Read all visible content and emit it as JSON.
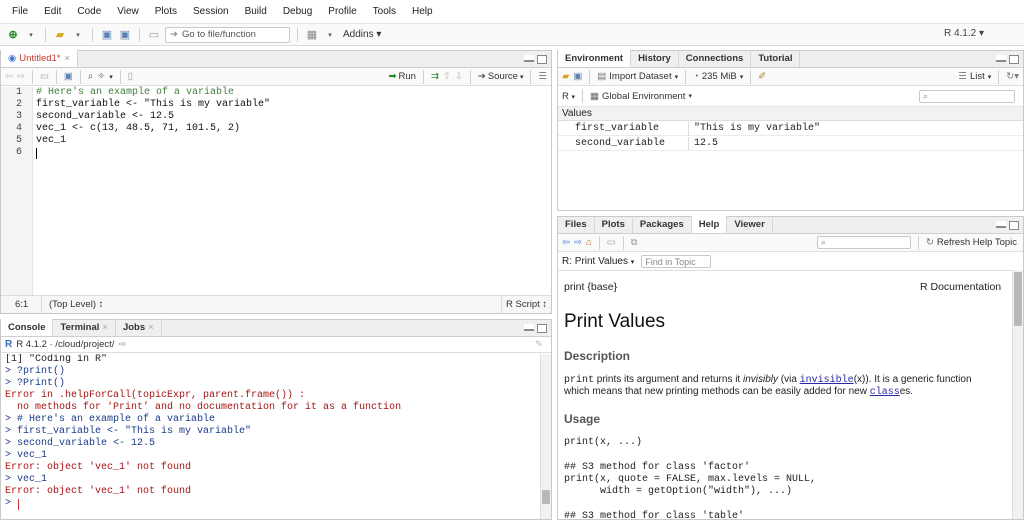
{
  "menu": [
    "File",
    "Edit",
    "Code",
    "View",
    "Plots",
    "Session",
    "Build",
    "Debug",
    "Profile",
    "Tools",
    "Help"
  ],
  "toolbar": {
    "goto_placeholder": "Go to file/function",
    "addins": "Addins",
    "r_version": "R 4.1.2"
  },
  "editor": {
    "tab_label": "Untitled1*",
    "run_label": "Run",
    "source_label": "Source",
    "lines": [
      {
        "n": "1",
        "text": "# Here's an example of a variable"
      },
      {
        "n": "2",
        "text": "first_variable <- \"This is my variable\""
      },
      {
        "n": "3",
        "text": "second_variable <- 12.5"
      },
      {
        "n": "4",
        "text": "vec_1 <- c(13, 48.5, 71, 101.5, 2)"
      },
      {
        "n": "5",
        "text": "vec_1"
      },
      {
        "n": "6",
        "text": ""
      }
    ],
    "cursor_pos": "6:1",
    "scope": "(Top Level) ↕",
    "filetype": "R Script ↕"
  },
  "console": {
    "tabs": [
      "Console",
      "Terminal",
      "Jobs"
    ],
    "path": "R 4.1.2 · /cloud/project/",
    "lines": [
      {
        "t": "[1] \"Coding in R\"",
        "k": "out"
      },
      {
        "t": "> ?print()",
        "k": "in"
      },
      {
        "t": "> ?Print()",
        "k": "in"
      },
      {
        "t": "Error in .helpForCall(topicExpr, parent.frame()) :",
        "k": "err"
      },
      {
        "t": "  no methods for ‘Print’ and no documentation for it as a function",
        "k": "err"
      },
      {
        "t": "> # Here's an example of a variable",
        "k": "in"
      },
      {
        "t": "> first_variable <- \"This is my variable\"",
        "k": "in"
      },
      {
        "t": "> second_variable <- 12.5",
        "k": "in"
      },
      {
        "t": "> vec_1",
        "k": "in"
      },
      {
        "t": "Error: object 'vec_1' not found",
        "k": "err"
      },
      {
        "t": "> vec_1",
        "k": "in"
      },
      {
        "t": "Error: object 'vec_1' not found",
        "k": "err"
      },
      {
        "t": ">",
        "k": "in"
      }
    ]
  },
  "environment": {
    "tabs": [
      "Environment",
      "History",
      "Connections",
      "Tutorial"
    ],
    "import_label": "Import Dataset",
    "memory": "235 MiB",
    "view_mode": "List",
    "lang": "R",
    "scope": "Global Environment",
    "section": "Values",
    "rows": [
      {
        "name": "first_variable",
        "value": "\"This is my variable\""
      },
      {
        "name": "second_variable",
        "value": "12.5"
      }
    ]
  },
  "help": {
    "tabs": [
      "Files",
      "Plots",
      "Packages",
      "Help",
      "Viewer"
    ],
    "refresh_label": "Refresh Help Topic",
    "topic": "R: Print Values",
    "find_placeholder": "Find in Topic",
    "pkg": "print {base}",
    "doc_label": "R Documentation",
    "title": "Print Values",
    "description_heading": "Description",
    "desc_code": "print",
    "desc_part1": " prints its argument and returns it ",
    "desc_italic": "invisibly",
    "desc_part2": " (via ",
    "desc_link": "invisible",
    "desc_part3": "(x)). It is a generic function",
    "desc_line2a": "which means that new printing methods can be easily added for new ",
    "desc_link2": "class",
    "desc_line2b": "es.",
    "usage_heading": "Usage",
    "usage_lines": [
      "print(x, ...)",
      "",
      "## S3 method for class 'factor'",
      "print(x, quote = FALSE, max.levels = NULL,",
      "      width = getOption(\"width\"), ...)",
      "",
      "## S3 method for class 'table'"
    ]
  },
  "colors": {
    "accent": "#3a7bd5",
    "error": "#a31515",
    "prompt": "#1b3a8a",
    "comment": "#3f7f3f"
  }
}
